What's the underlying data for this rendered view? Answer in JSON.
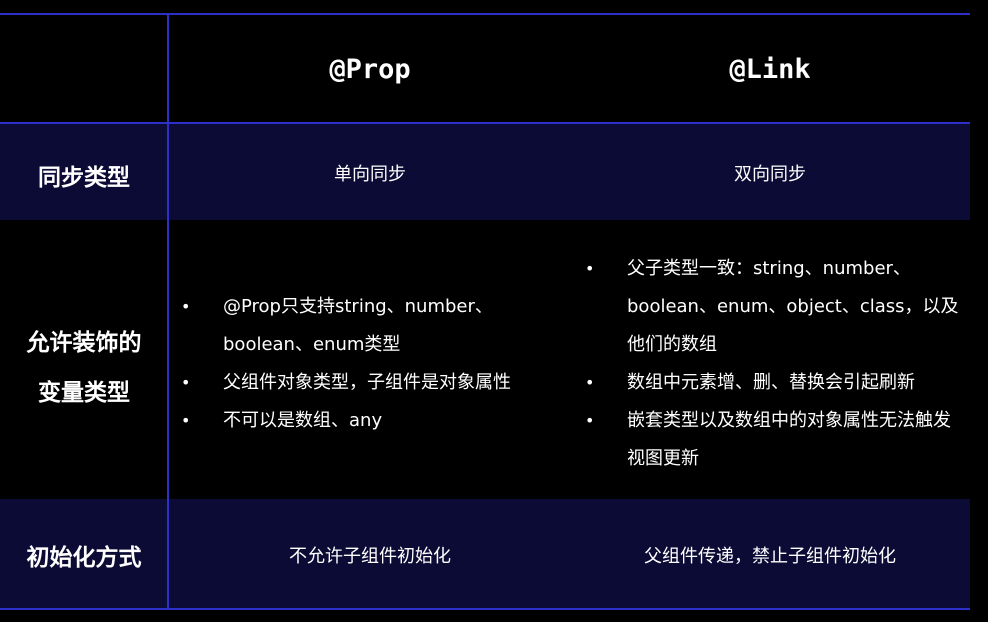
{
  "table": {
    "headers": [
      "@Prop",
      "@Link"
    ],
    "rows": [
      {
        "label": [
          "同步类型"
        ],
        "prop": "单向同步",
        "link": "双向同步"
      },
      {
        "label": [
          "允许装饰的",
          "变量类型"
        ],
        "prop_items": [
          "@Prop只支持string、number、boolean、enum类型",
          "父组件对象类型，子组件是对象属性",
          "不可以是数组、any"
        ],
        "link_items": [
          "父子类型一致：string、number、boolean、enum、object、class，以及他们的数组",
          "数组中元素增、删、替换会引起刷新",
          "嵌套类型以及数组中的对象属性无法触发视图更新"
        ]
      },
      {
        "label": [
          "初始化方式"
        ],
        "prop": "不允许子组件初始化",
        "link": "父组件传递，禁止子组件初始化"
      }
    ]
  },
  "colors": {
    "background": "#000000",
    "band": "#0b0b35",
    "grid": "#2c2fc8",
    "text": "#ffffff"
  }
}
